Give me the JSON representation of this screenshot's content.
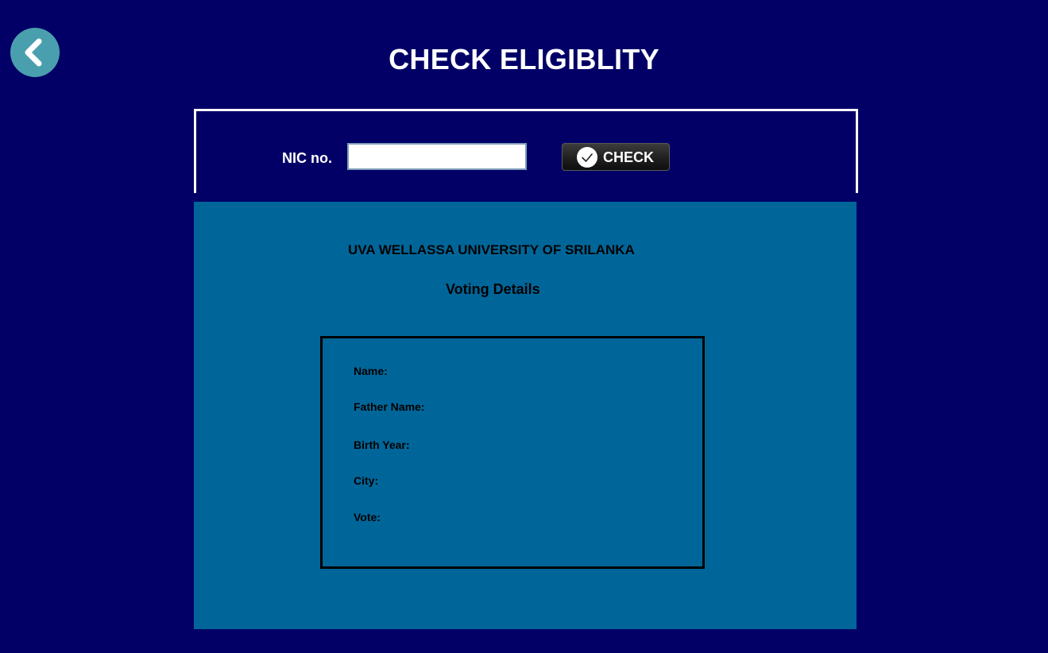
{
  "header": {
    "title": "CHECK ELIGIBLITY",
    "back_icon": "chevron-left-icon"
  },
  "search": {
    "nic_label": "NIC no.",
    "nic_value": "",
    "check_label": "CHECK",
    "check_icon": "checkmark-circle-icon"
  },
  "details": {
    "university": "UVA WELLASSA UNIVERSITY OF SRILANKA",
    "heading": "Voting Details",
    "fields": {
      "name": "Name:",
      "father_name": "Father Name:",
      "birth_year": "Birth Year:",
      "city": "City:",
      "vote": "Vote:"
    }
  },
  "colors": {
    "background": "#020066",
    "panel": "#006699",
    "back_button": "#4a9fae",
    "text_light": "#ffffff",
    "text_dark": "#000000"
  }
}
